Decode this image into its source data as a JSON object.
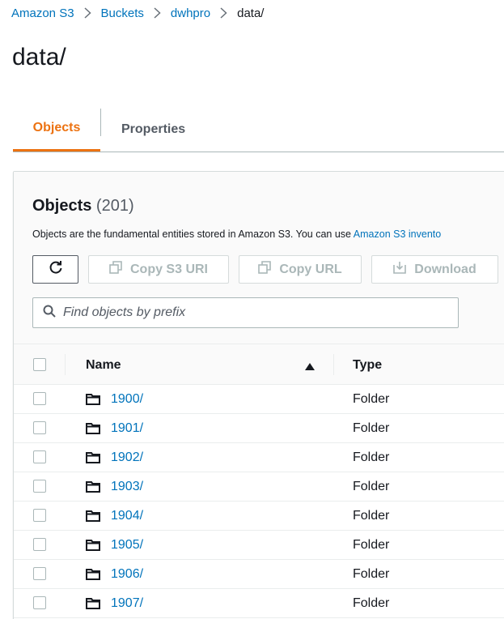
{
  "breadcrumb": [
    {
      "label": "Amazon S3",
      "link": true
    },
    {
      "label": "Buckets",
      "link": true
    },
    {
      "label": "dwhpro",
      "link": true
    },
    {
      "label": "data/",
      "link": false
    }
  ],
  "page_title": "data/",
  "tabs": [
    {
      "label": "Objects",
      "active": true
    },
    {
      "label": "Properties",
      "active": false
    }
  ],
  "objects_section": {
    "title": "Objects",
    "count": "(201)",
    "description_text": "Objects are the fundamental entities stored in Amazon S3. You can use ",
    "description_link": "Amazon S3 invento"
  },
  "toolbar": {
    "copy_uri_label": "Copy S3 URI",
    "copy_url_label": "Copy URL",
    "download_label": "Download"
  },
  "search": {
    "placeholder": "Find objects by prefix"
  },
  "table": {
    "columns": [
      "Name",
      "Type"
    ],
    "sort": "ascending",
    "rows": [
      {
        "name": "1900/",
        "type": "Folder"
      },
      {
        "name": "1901/",
        "type": "Folder"
      },
      {
        "name": "1902/",
        "type": "Folder"
      },
      {
        "name": "1903/",
        "type": "Folder"
      },
      {
        "name": "1904/",
        "type": "Folder"
      },
      {
        "name": "1905/",
        "type": "Folder"
      },
      {
        "name": "1906/",
        "type": "Folder"
      },
      {
        "name": "1907/",
        "type": "Folder"
      }
    ]
  },
  "colors": {
    "link": "#0073bb",
    "accent": "#ec7211",
    "disabled": "#aab7b8",
    "text": "#16191f"
  },
  "icons": {
    "breadcrumb_separator": "chevron-right-icon",
    "refresh": "refresh-icon",
    "copy": "copy-icon",
    "download": "download-icon",
    "search": "search-icon",
    "sort": "sort-ascending-icon",
    "folder": "folder-icon"
  }
}
